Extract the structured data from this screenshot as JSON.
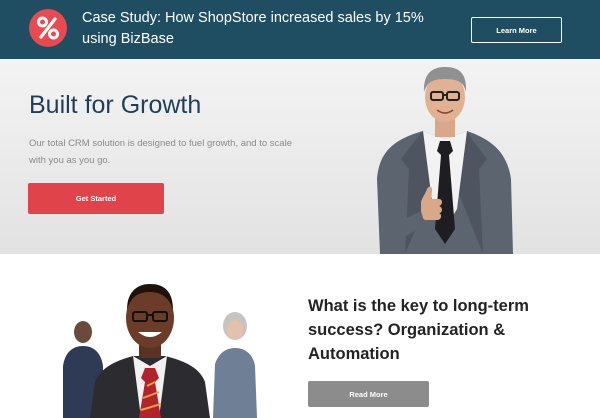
{
  "banner": {
    "text": "Case Study: How ShopStore increased sales by 15% using BizBase",
    "button_label": "Learn More",
    "badge_icon": "percent-icon",
    "background_color": "#1f4e63",
    "badge_color": "#e84a4f"
  },
  "hero": {
    "title": "Built for Growth",
    "description": "Our total CRM solution is designed to fuel growth, and to scale with you as you go.",
    "cta_label": "Get Started",
    "cta_color": "#e0434a",
    "title_color": "#1f3f58"
  },
  "section": {
    "heading": "What is the key to long-term success? Organization & Automation",
    "button_label": "Read More",
    "button_color": "#8c8c8c"
  }
}
